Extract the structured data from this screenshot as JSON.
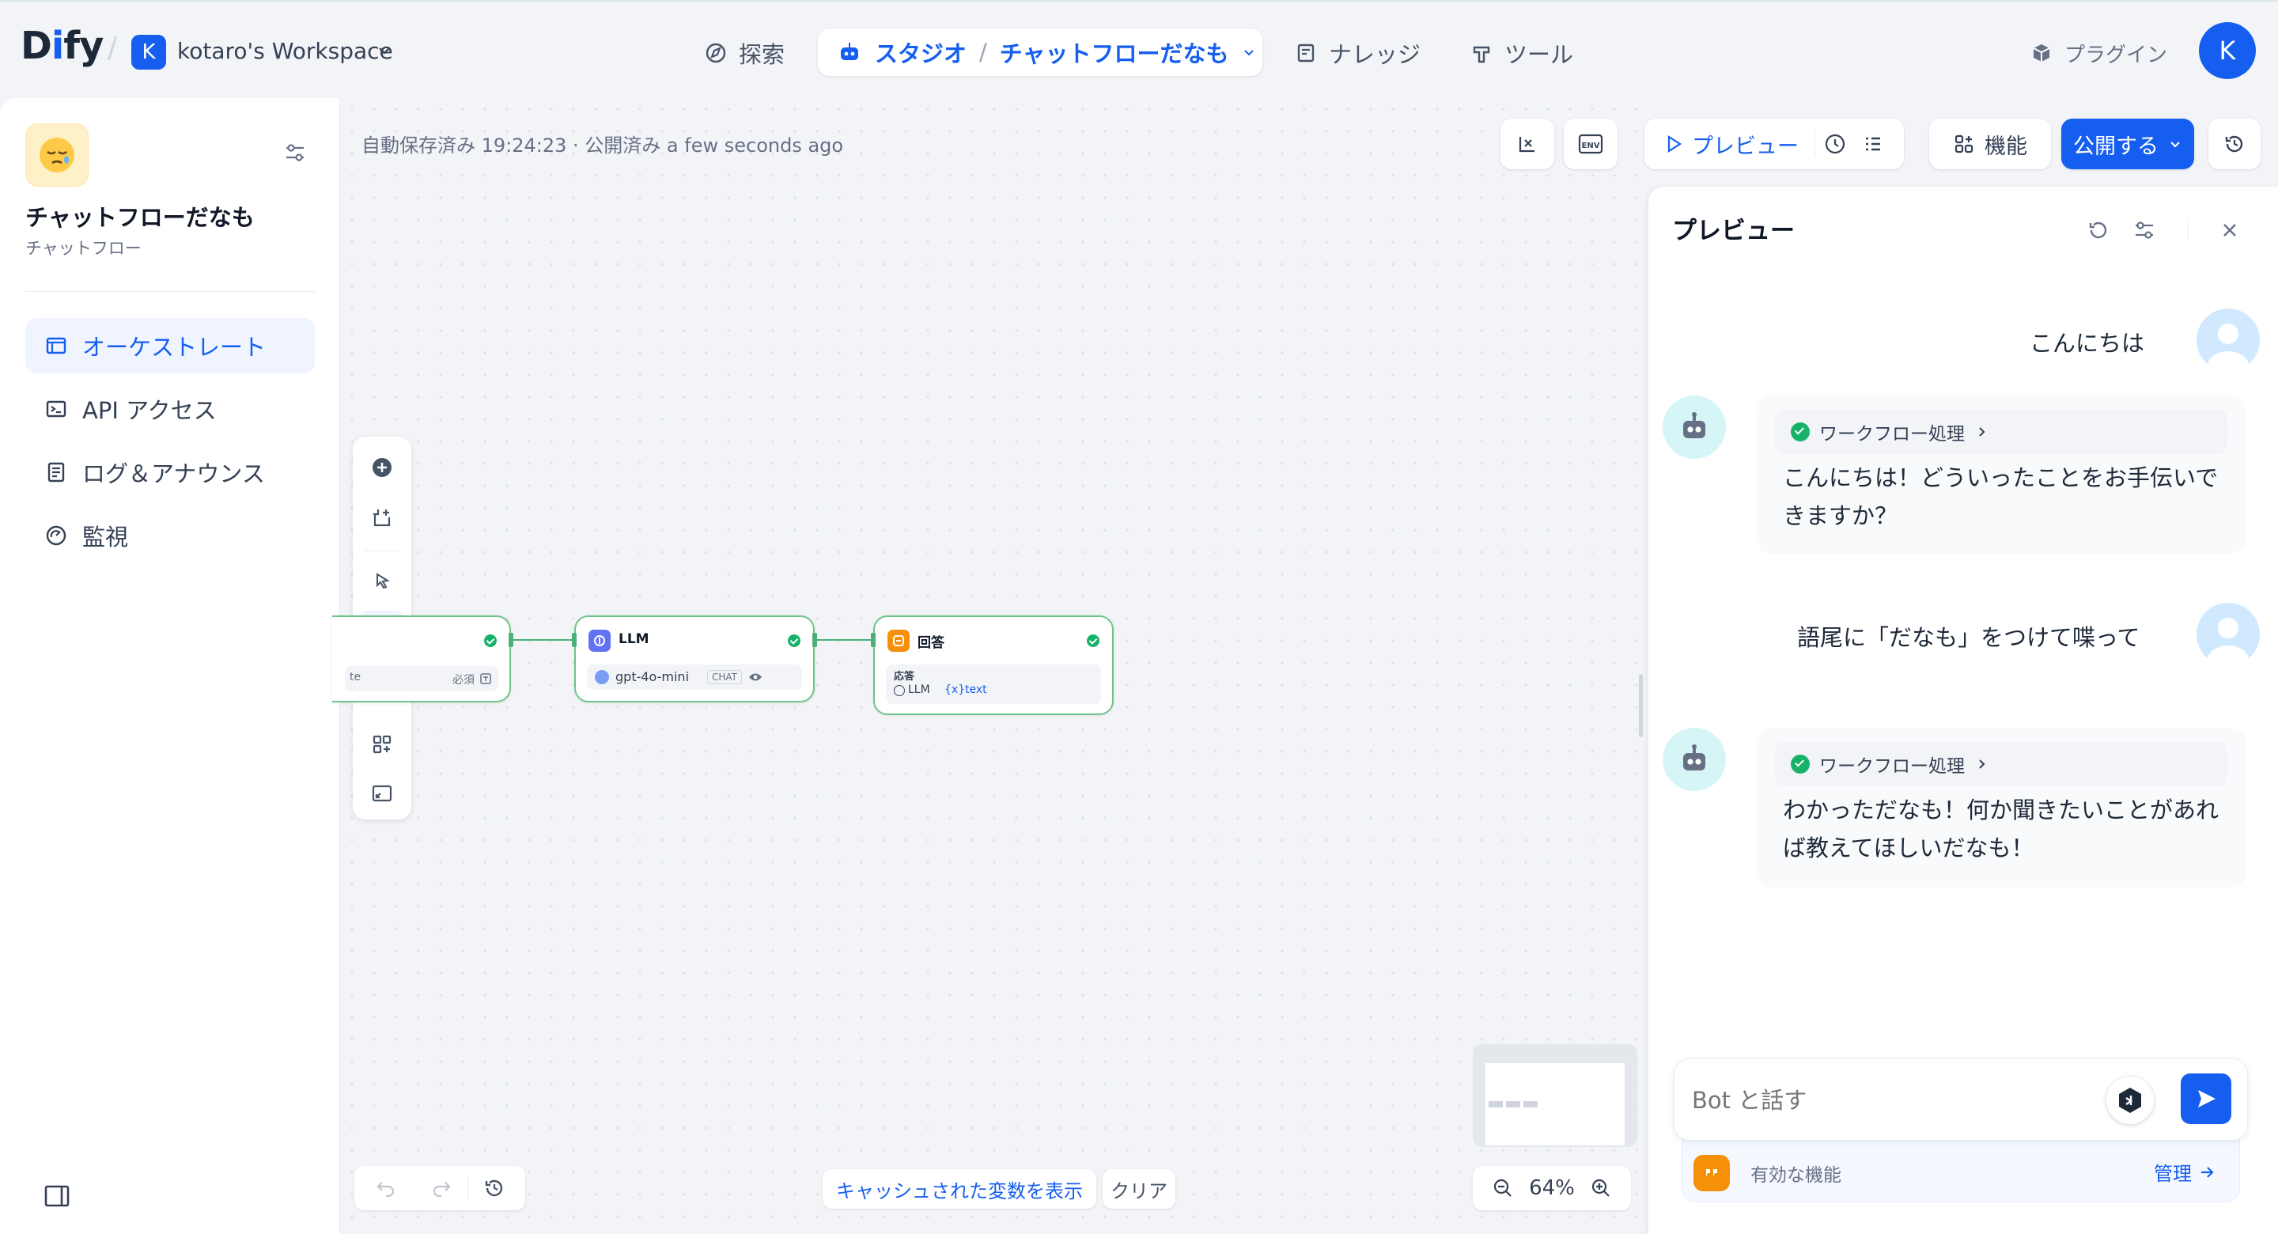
{
  "header": {
    "logo": "Dify",
    "workspace_initial": "K",
    "workspace_name": "kotaro's Workspace",
    "nav": {
      "explore": "探索",
      "studio": "スタジオ",
      "current_app": "チャットフローだなも",
      "knowledge": "ナレッジ",
      "tools": "ツール",
      "plugins": "プラグイン"
    },
    "user_initial": "K"
  },
  "sidebar": {
    "app_name": "チャットフローだなも",
    "app_type": "チャットフロー",
    "items": [
      {
        "label": "オーケストレート",
        "icon": "layout-icon",
        "active": true
      },
      {
        "label": "API アクセス",
        "icon": "terminal-icon"
      },
      {
        "label": "ログ＆アナウンス",
        "icon": "log-icon"
      },
      {
        "label": "監視",
        "icon": "monitor-icon"
      }
    ]
  },
  "canvas": {
    "autosave": "自動保存済み 19:24:23 · 公開済み a few seconds ago",
    "toolbar": {
      "preview": "プレビュー",
      "features": "機能",
      "publish": "公開する"
    },
    "nodes": {
      "start_required": "必須",
      "start_partial": "te",
      "llm_title": "LLM",
      "llm_model": "gpt-4o-mini",
      "llm_mode": "CHAT",
      "answer_title": "回答",
      "answer_label": "応答",
      "answer_ref_node": "LLM",
      "answer_ref_var": "text",
      "answer_ref_prefix": "{x}"
    },
    "show_cached_vars": "キャッシュされた変数を表示",
    "clear": "クリア",
    "zoom": "64%"
  },
  "preview": {
    "title": "プレビュー",
    "messages": [
      {
        "role": "user",
        "text": "こんにちは"
      },
      {
        "role": "bot",
        "workflow": "ワークフロー処理",
        "text": "こんにちは！どういったことをお手伝いできますか？"
      },
      {
        "role": "user",
        "text": "語尾に「だなも」をつけて喋って"
      },
      {
        "role": "bot",
        "workflow": "ワークフロー処理",
        "text": "わかっただなも！何か聞きたいことがあれば教えてほしいだなも！"
      }
    ],
    "input_placeholder": "Bot と話す",
    "features_label": "有効な機能",
    "manage": "管理"
  },
  "colors": {
    "accent": "#155eef",
    "success": "#17b26a",
    "answer_node": "#f79009",
    "llm_node": "#6172f3"
  }
}
